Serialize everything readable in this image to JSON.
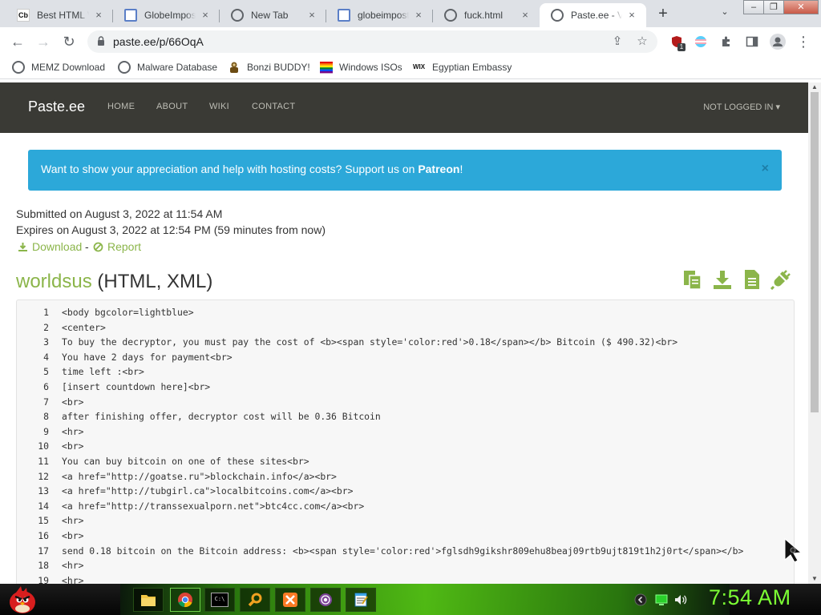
{
  "browser": {
    "tabs": [
      {
        "title": "Best HTML Viewer",
        "favicon": "cb-favicon-icon",
        "active": false
      },
      {
        "title": "GlobeImposter",
        "favicon": "paste-favicon-icon",
        "active": false
      },
      {
        "title": "New Tab",
        "favicon": "chrome-favicon-icon",
        "active": false
      },
      {
        "title": "globeimposter",
        "favicon": "paste-favicon-icon",
        "active": false
      },
      {
        "title": "fuck.html",
        "favicon": "globe-favicon-icon",
        "active": false
      },
      {
        "title": "Paste.ee - View",
        "favicon": "globe-favicon-icon",
        "active": true
      }
    ],
    "cb_text": "Cb",
    "new_tab": "+",
    "tab_search": "⌄",
    "close_glyph": "×",
    "window_controls": {
      "minimize": "–",
      "restore": "❐",
      "close": "✕"
    },
    "nav": {
      "back": "←",
      "forward": "→",
      "reload": "↻",
      "share": "⇪",
      "star": "☆",
      "menu": "⋮"
    },
    "url": "paste.ee/p/66OqA",
    "ext_badge": "1",
    "bookmarks": [
      "MEMZ Download",
      "Malware Database",
      "Bonzi BUDDY!",
      "Windows ISOs",
      "Egyptian Embassy"
    ],
    "wix_text": "WIX"
  },
  "site": {
    "brand": "Paste.ee",
    "nav": [
      "HOME",
      "ABOUT",
      "WIKI",
      "CONTACT"
    ],
    "login": "NOT LOGGED IN ▾",
    "banner": {
      "text": "Want to show your appreciation and help with hosting costs? Support us on ",
      "link": "Patreon",
      "suffix": "!",
      "close": "×"
    },
    "submitted": "Submitted on August 3, 2022 at 11:54 AM",
    "expires": "Expires on August 3, 2022 at 12:54 PM (59 minutes from now)",
    "download_label": "Download",
    "separator": "-",
    "report_label": "Report",
    "paste_name": "worldsus",
    "paste_lang": "(HTML, XML)",
    "colors": {
      "accent": "#8bb54a",
      "banner": "#2ca8d9",
      "nav_bg": "#3a3a35"
    }
  },
  "code": {
    "lines": [
      "<body bgcolor=lightblue>",
      "<center>",
      "To buy the decryptor, you must pay the cost of <b><span style='color:red'>0.18</span></b> Bitcoin ($ 490.32)<br>",
      "You have 2 days for payment<br>",
      "time left :<br>",
      "[insert countdown here]<br>",
      "<br>",
      "after finishing offer, decryptor cost will be 0.36 Bitcoin",
      "<hr>",
      "<br>",
      "You can buy bitcoin on one of these sites<br>",
      "<a href=\"http://goatse.ru\">blockchain.info</a><br>",
      "<a href=\"http://tubgirl.ca\">localbitcoins.com</a><br>",
      "<a href=\"http://transsexualporn.net\">btc4cc.com</a><br>",
      "<hr>",
      "<br>",
      "send 0.18 bitcoin on the Bitcoin address: <b><span style='color:red'>fglsdh9gikshr809ehu8beaj09rtb9ujt819t1h2j0rt</span></b>",
      "<hr>",
      "<hr>"
    ]
  },
  "taskbar": {
    "clock": "7:54 AM",
    "cmd_text": "C:\\"
  }
}
